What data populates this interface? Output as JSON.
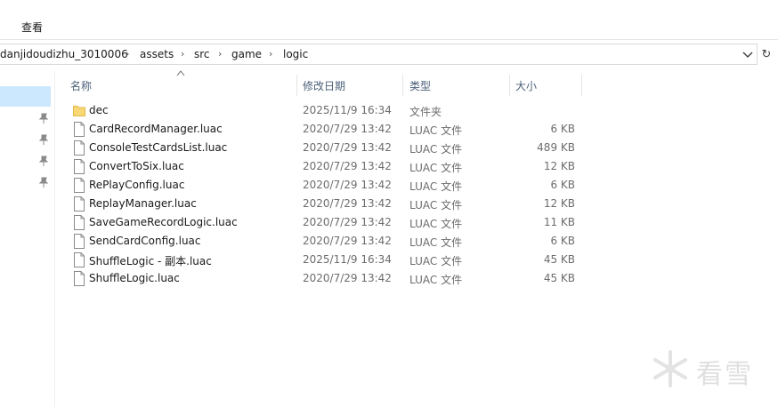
{
  "ribbon": {
    "tab_view": "查看"
  },
  "address_bar": {
    "segments": [
      "danjidoudizhu_3010006",
      "assets",
      "src",
      "game",
      "logic"
    ]
  },
  "columns": {
    "name": "名称",
    "date": "修改日期",
    "type": "类型",
    "size": "大小"
  },
  "files": [
    {
      "name": "dec",
      "date": "2025/11/9 16:34",
      "type": "文件夹",
      "size": "",
      "icon": "folder-icon"
    },
    {
      "name": "CardRecordManager.luac",
      "date": "2020/7/29 13:42",
      "type": "LUAC 文件",
      "size": "6 KB",
      "icon": "file-icon"
    },
    {
      "name": "ConsoleTestCardsList.luac",
      "date": "2020/7/29 13:42",
      "type": "LUAC 文件",
      "size": "489 KB",
      "icon": "file-icon"
    },
    {
      "name": "ConvertToSix.luac",
      "date": "2020/7/29 13:42",
      "type": "LUAC 文件",
      "size": "12 KB",
      "icon": "file-icon"
    },
    {
      "name": "RePlayConfig.luac",
      "date": "2020/7/29 13:42",
      "type": "LUAC 文件",
      "size": "6 KB",
      "icon": "file-icon"
    },
    {
      "name": "ReplayManager.luac",
      "date": "2020/7/29 13:42",
      "type": "LUAC 文件",
      "size": "12 KB",
      "icon": "file-icon"
    },
    {
      "name": "SaveGameRecordLogic.luac",
      "date": "2020/7/29 13:42",
      "type": "LUAC 文件",
      "size": "11 KB",
      "icon": "file-icon"
    },
    {
      "name": "SendCardConfig.luac",
      "date": "2020/7/29 13:42",
      "type": "LUAC 文件",
      "size": "6 KB",
      "icon": "file-icon"
    },
    {
      "name": "ShuffleLogic - 副本.luac",
      "date": "2025/11/9 16:34",
      "type": "LUAC 文件",
      "size": "45 KB",
      "icon": "file-icon"
    },
    {
      "name": "ShuffleLogic.luac",
      "date": "2020/7/29 13:42",
      "type": "LUAC 文件",
      "size": "45 KB",
      "icon": "file-icon"
    }
  ],
  "watermark": {
    "text": "看雪"
  },
  "colors": {
    "selection": "#cce8ff",
    "folder": "#f8d775",
    "header_text": "#4c607a"
  }
}
